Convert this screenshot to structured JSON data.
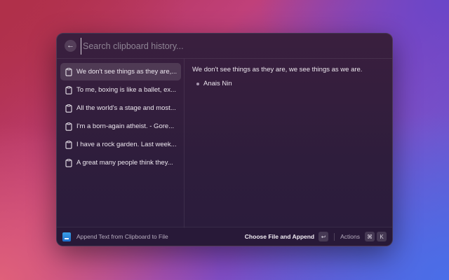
{
  "search": {
    "placeholder": "Search clipboard history..."
  },
  "sidebar": {
    "items": [
      {
        "label": "We don't see things as they are,...",
        "icon": "clipboard-icon",
        "selected": true
      },
      {
        "label": "To me, boxing is like a ballet, ex...",
        "icon": "clipboard-icon"
      },
      {
        "label": "All the world's a stage and most...",
        "icon": "clipboard-icon"
      },
      {
        "label": "I'm a born-again atheist. - Gore...",
        "icon": "clipboard-icon"
      },
      {
        "label": "I have a rock garden. Last week...",
        "icon": "clipboard-icon"
      },
      {
        "label": "A great many people think they...",
        "icon": "clipboard-icon"
      }
    ]
  },
  "detail": {
    "text": "We don't see things as they are, we see things as we are.",
    "author": "Anais Nin"
  },
  "footer": {
    "extension_title": "Append Text from Clipboard to File",
    "primary_action": "Choose File and Append",
    "primary_shortcut": "↩",
    "actions_label": "Actions",
    "actions_shortcut_1": "⌘",
    "actions_shortcut_2": "K"
  },
  "colors": {
    "window_bg": "#2e1d3c",
    "selected_item_bg": "#4a3a55",
    "extension_icon": "#2a86d8"
  }
}
